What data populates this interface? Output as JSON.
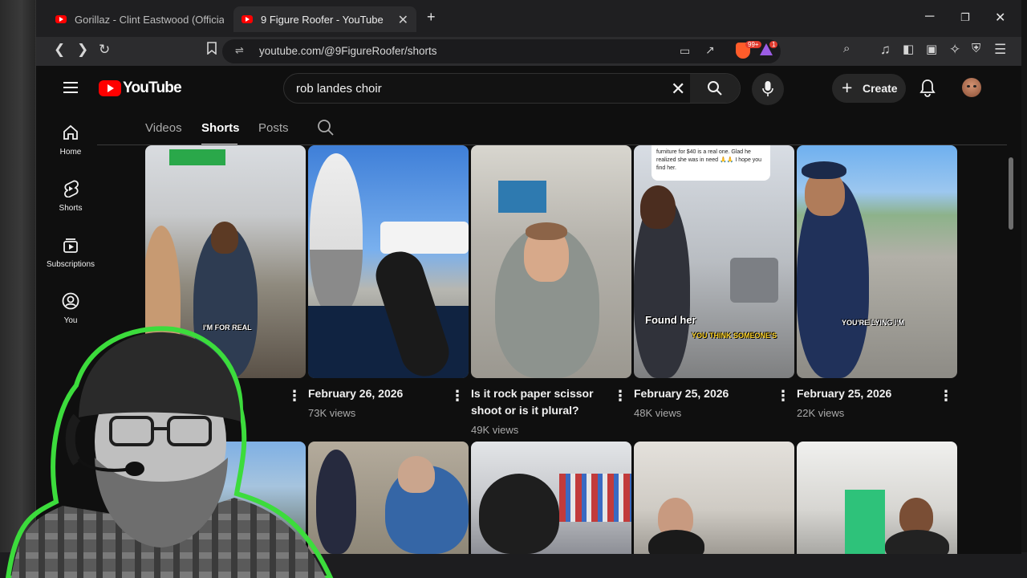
{
  "browser": {
    "tabs": [
      {
        "title": "Gorillaz - Clint Eastwood (Official Vid",
        "active": false
      },
      {
        "title": "9 Figure Roofer - YouTube",
        "active": true
      }
    ],
    "new_tab": "+",
    "url": "youtube.com/@9FigureRoofer/shorts",
    "window_controls": [
      "minimize",
      "maximize",
      "close"
    ],
    "shield_badge": "99+",
    "alert_badge": "1"
  },
  "youtube": {
    "logo_text": "YouTube",
    "search_value": "rob landes choir",
    "create_label": "Create",
    "guide": [
      {
        "label": "Home",
        "icon": "home-icon"
      },
      {
        "label": "Shorts",
        "icon": "shorts-icon"
      },
      {
        "label": "Subscriptions",
        "icon": "subscriptions-icon"
      },
      {
        "label": "You",
        "icon": "you-icon"
      }
    ],
    "channel_tabs": [
      {
        "label": "Videos",
        "active": false
      },
      {
        "label": "Shorts",
        "active": true
      },
      {
        "label": "Posts",
        "active": false
      }
    ],
    "shorts_row1": [
      {
        "title": "",
        "views": "",
        "caption": "I'M FOR REAL"
      },
      {
        "title": "February 26, 2026",
        "views": "73K views",
        "caption": ""
      },
      {
        "title": "Is it rock paper scissor shoot or is it plural?",
        "views": "49K views",
        "caption": ""
      },
      {
        "title": "February 25, 2026",
        "views": "48K views",
        "caption": "Found her",
        "caption2": "YOU THINK SOMEONE'S",
        "note": "furniture for $40 is a real one. Glad he realized she was in need 🙏🙏 I hope you find her."
      },
      {
        "title": "February 25, 2026",
        "views": "22K views",
        "caption": "YOU'RE LYING I'M"
      }
    ]
  },
  "colors": {
    "youtube_red": "#ff0000",
    "page_bg": "#0f0f0f",
    "webcam_ring": "#3cdc3c"
  }
}
